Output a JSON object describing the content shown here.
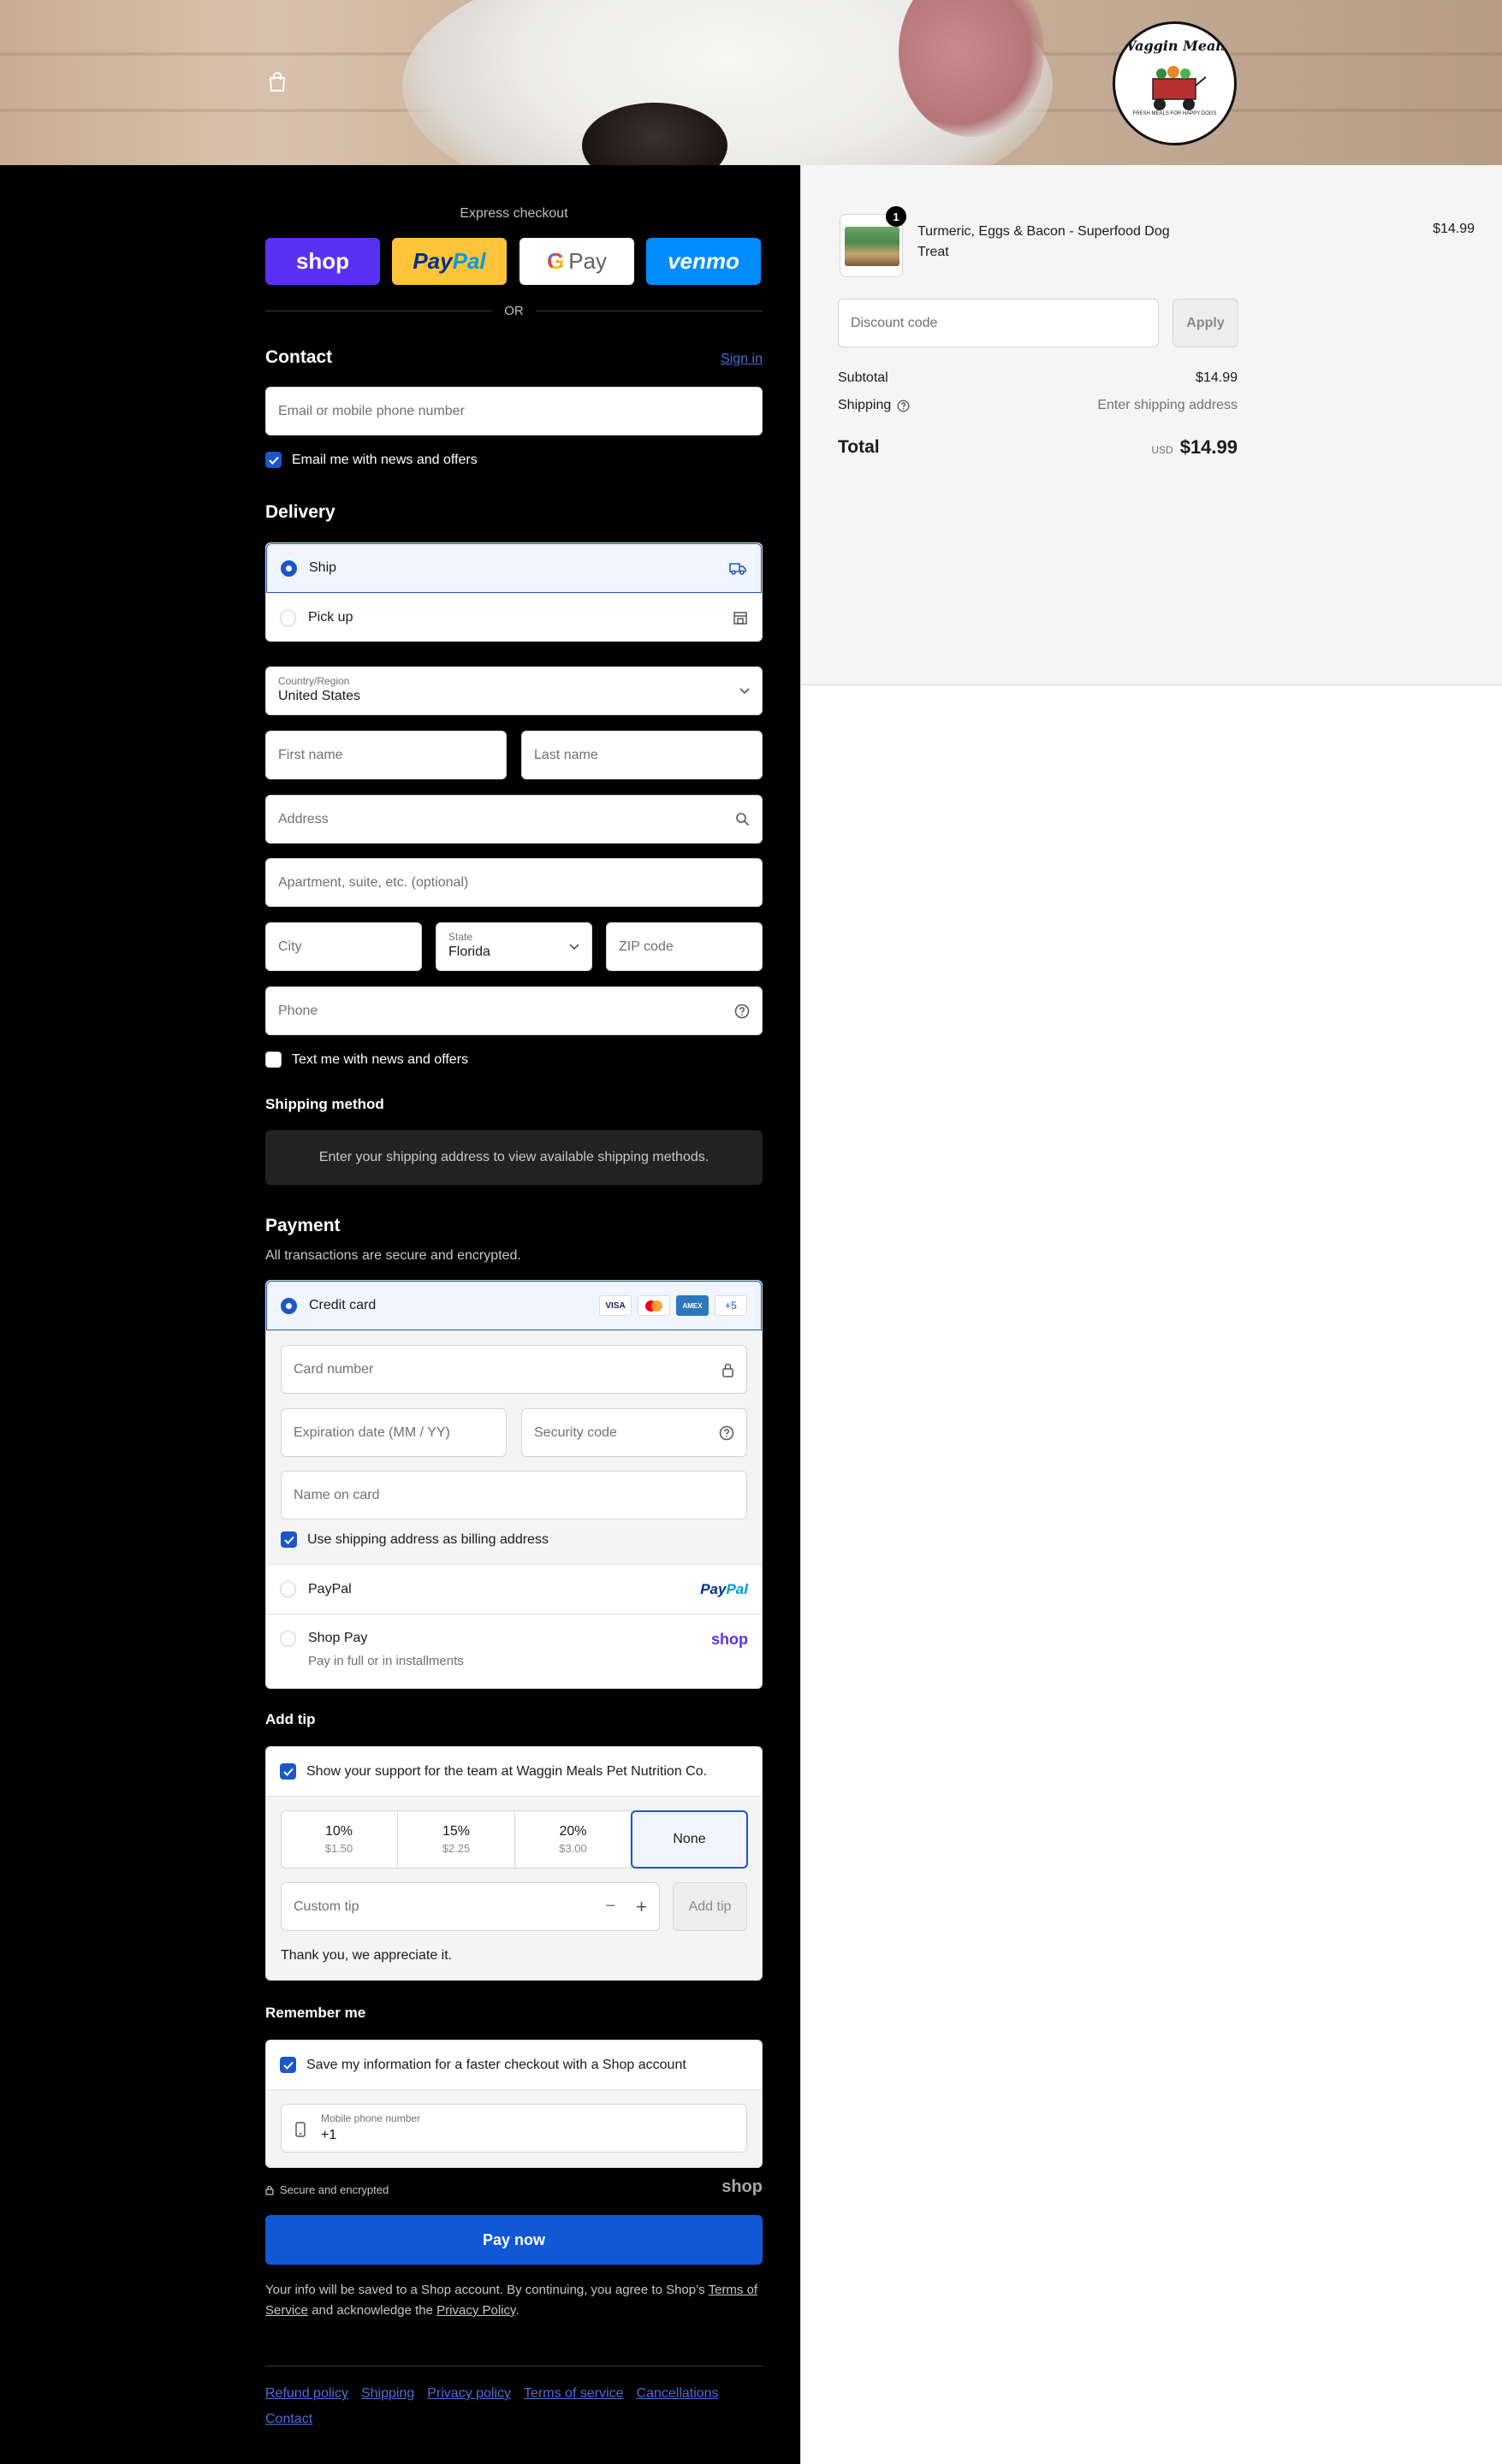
{
  "express": {
    "title": "Express checkout",
    "shop_label": "shop",
    "paypal_label_a": "Pay",
    "paypal_label_b": "Pal",
    "gpay_g": "G",
    "gpay_label": "Pay",
    "venmo_label": "venmo",
    "or_label": "OR"
  },
  "logo": {
    "text": "Waggin Meals",
    "tagline": "FRESH MEALS FOR HAPPY DOGS"
  },
  "contact": {
    "heading": "Contact",
    "sign_in": "Sign in",
    "email_placeholder": "Email or mobile phone number",
    "news_checkbox": "Email me with news and offers",
    "news_checked": true
  },
  "delivery": {
    "heading": "Delivery",
    "options": [
      {
        "label": "Ship",
        "selected": true,
        "icon": "truck-icon"
      },
      {
        "label": "Pick up",
        "selected": false,
        "icon": "store-icon"
      }
    ],
    "country_label": "Country/Region",
    "country_value": "United States",
    "first_name": "First name",
    "last_name": "Last name",
    "address": "Address",
    "apartment": "Apartment, suite, etc. (optional)",
    "city": "City",
    "state_label": "State",
    "state_value": "Florida",
    "zip": "ZIP code",
    "phone": "Phone",
    "text_checkbox": "Text me with news and offers",
    "text_checked": false
  },
  "shipping_method": {
    "heading": "Shipping method",
    "notice": "Enter your shipping address to view available shipping methods."
  },
  "payment": {
    "heading": "Payment",
    "subtitle": "All transactions are secure and encrypted.",
    "credit_card_label": "Credit card",
    "card_brands": [
      "VISA",
      "MC",
      "AMEX"
    ],
    "more_brands": "+5",
    "card_number": "Card number",
    "expiry": "Expiration date (MM / YY)",
    "security_code": "Security code",
    "name_on_card": "Name on card",
    "billing_checkbox": "Use shipping address as billing address",
    "billing_checked": true,
    "paypal_label": "PayPal",
    "paypal_logo_a": "Pay",
    "paypal_logo_b": "Pal",
    "shoppay_label": "Shop Pay",
    "shoppay_sub": "Pay in full or in installments",
    "shoppay_logo": "shop"
  },
  "tip": {
    "heading": "Add tip",
    "support_checkbox": "Show your support for the team at Waggin Meals Pet Nutrition Co.",
    "support_checked": true,
    "options": [
      {
        "pct": "10%",
        "amt": "$1.50"
      },
      {
        "pct": "15%",
        "amt": "$2.25"
      },
      {
        "pct": "20%",
        "amt": "$3.00"
      }
    ],
    "none_label": "None",
    "custom_placeholder": "Custom tip",
    "minus": "−",
    "plus": "+",
    "add_tip": "Add tip",
    "thanks": "Thank you, we appreciate it."
  },
  "remember": {
    "heading": "Remember me",
    "save_checkbox": "Save my information for a faster checkout with a Shop account",
    "save_checked": true,
    "phone_label": "Mobile phone number",
    "phone_value": "+1",
    "secure_label": "Secure and encrypted",
    "shop_logo": "shop"
  },
  "pay_now": "Pay now",
  "legal": {
    "part1": "Your info will be saved to a Shop account. By continuing, you agree to Shop’s",
    "tos": "Terms of Service",
    "part2": "and acknowledge the",
    "privacy": "Privacy Policy",
    "end": "."
  },
  "footer": [
    "Refund policy",
    "Shipping",
    "Privacy policy",
    "Terms of service",
    "Cancellations",
    "Contact"
  ],
  "summary": {
    "item_name": "Turmeric, Eggs & Bacon - Superfood Dog Treat",
    "item_price": "$14.99",
    "quantity": "1",
    "discount_placeholder": "Discount code",
    "apply": "Apply",
    "subtotal_label": "Subtotal",
    "subtotal_value": "$14.99",
    "shipping_label": "Shipping",
    "shipping_value": "Enter shipping address",
    "total_label": "Total",
    "total_currency": "USD",
    "total_value": "$14.99"
  },
  "colors": {
    "accent": "#1c57c7",
    "pay_button": "#1058d6",
    "link": "#4a6fd8"
  }
}
